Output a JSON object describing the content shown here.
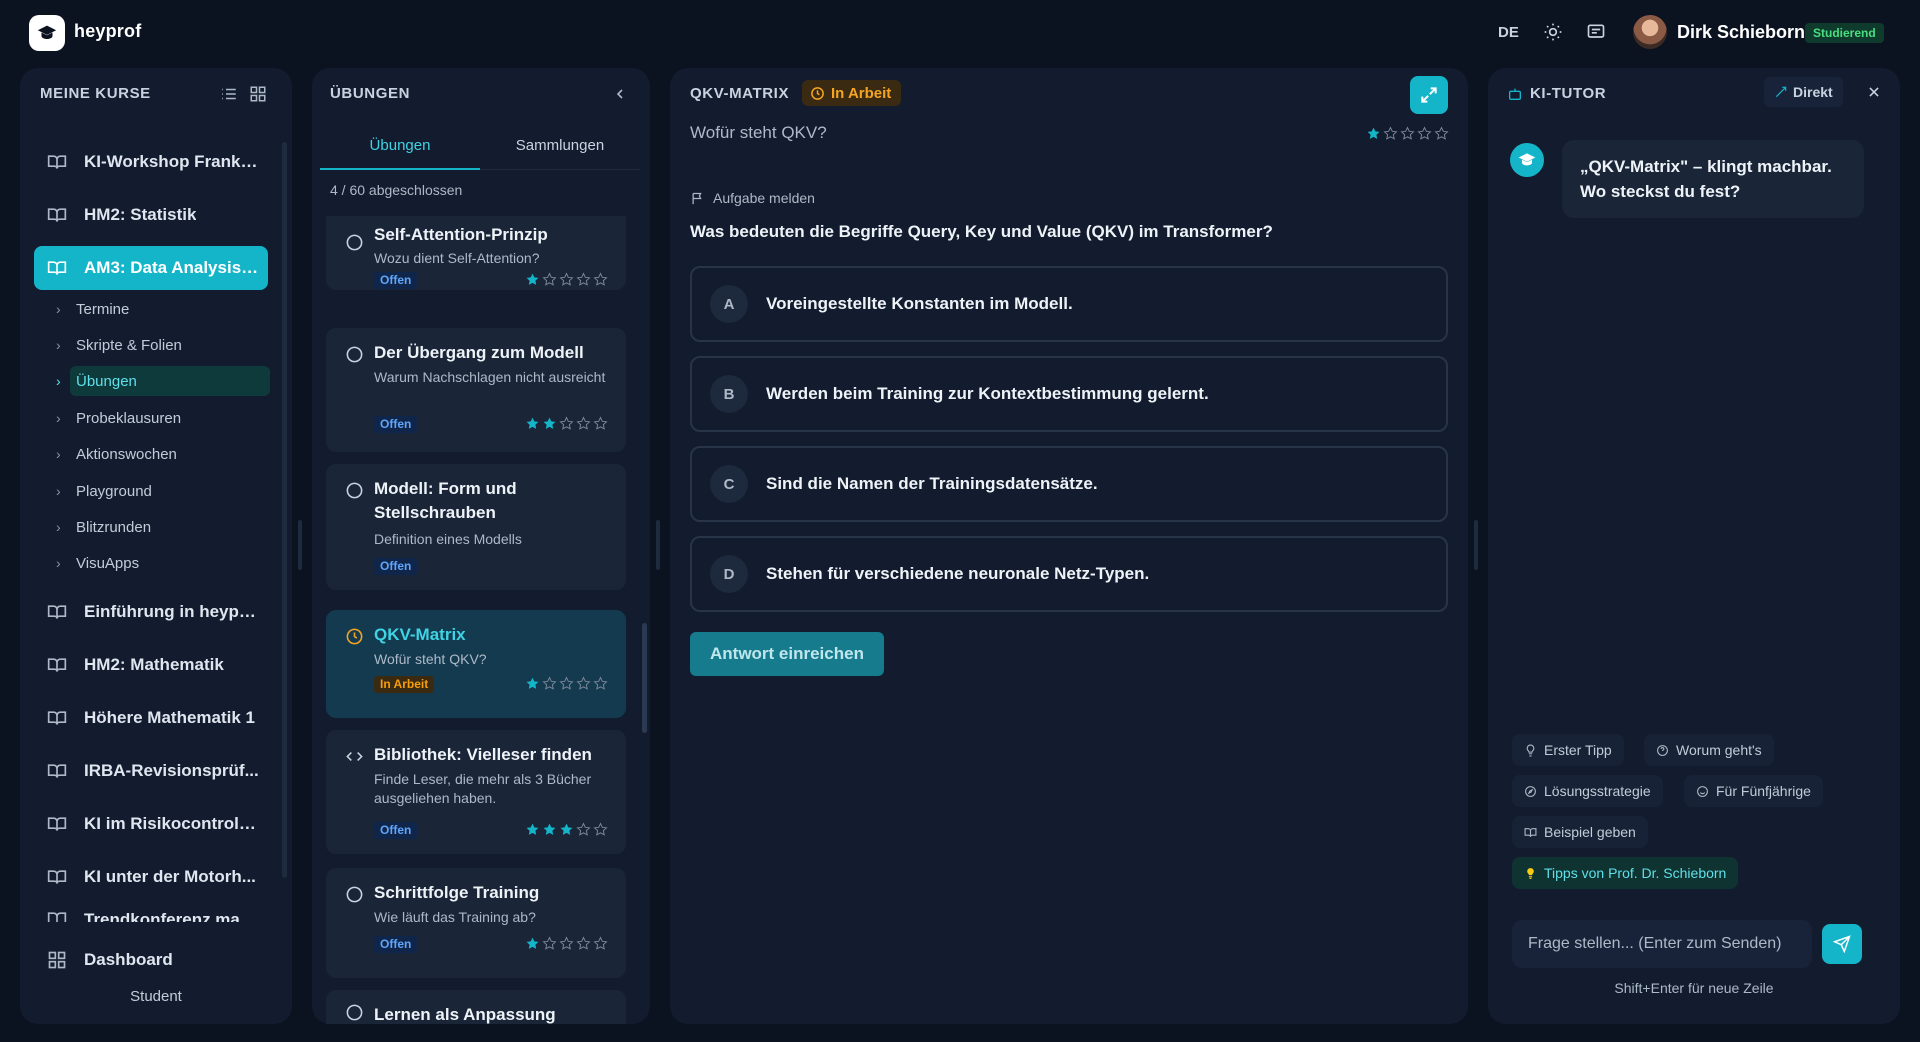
{
  "header": {
    "brand": "heyprof",
    "language": "DE",
    "user_name": "Dirk Schieborn",
    "role": "Studierend"
  },
  "courses": {
    "title": "MEINE KURSE",
    "items": [
      {
        "label": "KI-Workshop Frankf..."
      },
      {
        "label": "HM2: Statistik"
      },
      {
        "label": "AM3: Data Analysis ..."
      },
      {
        "label": "Einführung in heyprof"
      },
      {
        "label": "HM2: Mathematik"
      },
      {
        "label": "Höhere Mathematik 1"
      },
      {
        "label": "IRBA-Revisionsprüf..."
      },
      {
        "label": "KI im Risikocontrolli..."
      },
      {
        "label": "KI unter der Motorh..."
      },
      {
        "label": "Trendkonferenz max..."
      }
    ],
    "subitems": [
      {
        "label": "Termine"
      },
      {
        "label": "Skripte & Folien"
      },
      {
        "label": "Übungen"
      },
      {
        "label": "Probeklausuren"
      },
      {
        "label": "Aktionswochen"
      },
      {
        "label": "Playground"
      },
      {
        "label": "Blitzrunden"
      },
      {
        "label": "VisuApps"
      }
    ],
    "dashboard": "Dashboard",
    "footer_role": "Student"
  },
  "exercises": {
    "title": "ÜBUNGEN",
    "tabs": [
      {
        "label": "Übungen"
      },
      {
        "label": "Sammlungen"
      }
    ],
    "progress": "4 / 60 abgeschlossen",
    "cards": [
      {
        "title": "Self-Attention-Prinzip",
        "subtitle": "Wozu dient Self-Attention?",
        "status": "Offen",
        "rating": 1
      },
      {
        "title": "Der Übergang zum Modell",
        "subtitle": "Warum Nachschlagen nicht ausreicht",
        "status": "Offen",
        "rating": 2
      },
      {
        "title": "Modell: Form und Stellschrauben",
        "subtitle": "Definition eines Modells",
        "status": "Offen",
        "rating": 0
      },
      {
        "title": "QKV-Matrix",
        "subtitle": "Wofür steht QKV?",
        "status": "In Arbeit",
        "rating": 1
      },
      {
        "title": "Bibliothek: Vielleser finden",
        "subtitle": "Finde Leser, die mehr als 3 Bücher ausgeliehen haben.",
        "status": "Offen",
        "rating": 3
      },
      {
        "title": "Schrittfolge Training",
        "subtitle": "Wie läuft das Training ab?",
        "status": "Offen",
        "rating": 1
      },
      {
        "title": "Lernen als Anpassung",
        "subtitle": "",
        "status": "",
        "rating": 0
      }
    ]
  },
  "task": {
    "title": "QKV-MATRIX",
    "status": "In Arbeit",
    "subtitle": "Wofür steht QKV?",
    "rating": 1,
    "report_label": "Aufgabe melden",
    "question": "Was bedeuten die Begriffe Query, Key und Value (QKV) im Transformer?",
    "options": [
      {
        "letter": "A",
        "text": "Voreingestellte Konstanten im Modell."
      },
      {
        "letter": "B",
        "text": "Werden beim Training zur Kontextbestimmung gelernt."
      },
      {
        "letter": "C",
        "text": "Sind die Namen der Trainingsdatensätze."
      },
      {
        "letter": "D",
        "text": "Stehen für verschiedene neuronale Netz-Typen."
      }
    ],
    "submit_label": "Antwort einreichen"
  },
  "tutor": {
    "title": "KI-TUTOR",
    "mode_label": "Direkt",
    "message": "„QKV-Matrix\" – klingt machbar. Wo steckst du fest?",
    "chips": [
      {
        "label": "Erster Tipp",
        "icon": "lightbulb-icon"
      },
      {
        "label": "Worum geht's",
        "icon": "question-circle-icon"
      },
      {
        "label": "Lösungsstrategie",
        "icon": "compass-icon"
      },
      {
        "label": "Für Fünfjährige",
        "icon": "smile-icon"
      },
      {
        "label": "Beispiel geben",
        "icon": "book-icon"
      },
      {
        "label": "Tipps von Prof. Dr. Schieborn",
        "icon": "bulb-icon"
      }
    ],
    "input_placeholder": "Frage stellen... (Enter zum Senden)",
    "hint": "Shift+Enter für neue Zeile"
  },
  "colors": {
    "accent": "#15b5c9",
    "background": "#0b1220",
    "panel": "#121c2e",
    "card": "#1a2538",
    "star": "#15b5c9",
    "status_open": "#60a5fa",
    "status_work": "#f59e0b",
    "role_badge": "#4ade80"
  }
}
